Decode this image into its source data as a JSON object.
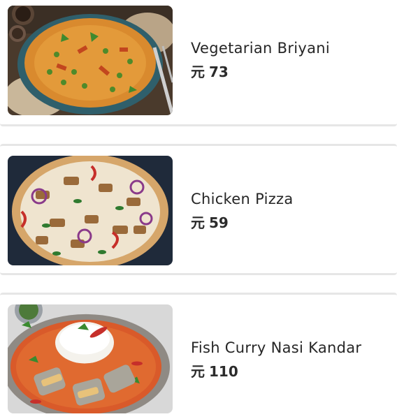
{
  "menu": {
    "items": [
      {
        "name": "Vegetarian Briyani",
        "currency": "元",
        "price": "73",
        "image_icon": "biryani-plate-image"
      },
      {
        "name": "Chicken Pizza",
        "currency": "元",
        "price": "59",
        "image_icon": "chicken-pizza-image"
      },
      {
        "name": "Fish Curry Nasi Kandar",
        "currency": "元",
        "price": "110",
        "image_icon": "fish-curry-image"
      }
    ]
  }
}
